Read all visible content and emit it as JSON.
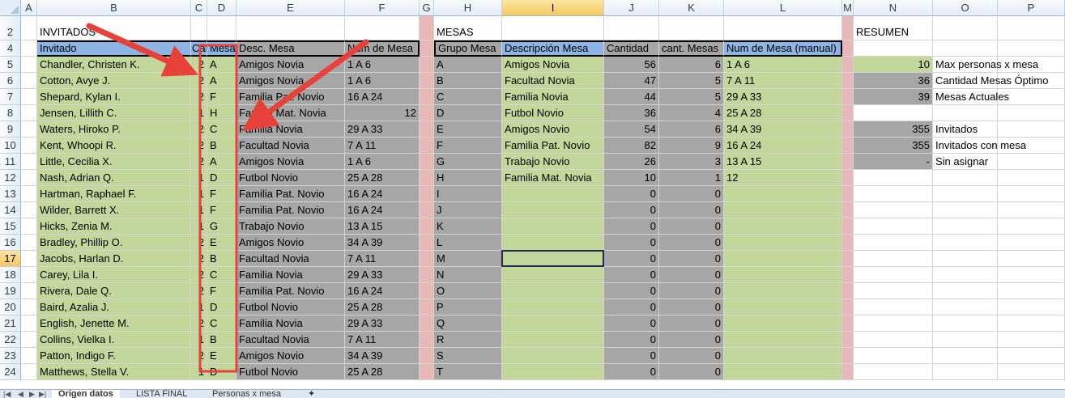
{
  "columns": [
    "A",
    "B",
    "C",
    "D",
    "E",
    "F",
    "G",
    "H",
    "I",
    "J",
    "K",
    "L",
    "M",
    "N",
    "O",
    "P"
  ],
  "selected_column": "I",
  "rows": [
    "2",
    "4",
    "5",
    "6",
    "7",
    "8",
    "9",
    "10",
    "11",
    "12",
    "13",
    "14",
    "15",
    "16",
    "17",
    "18",
    "19",
    "20",
    "21",
    "22",
    "23",
    "24"
  ],
  "selected_row": "17",
  "section_titles": {
    "invitados": "INVITADOS",
    "mesas": "MESAS",
    "resumen": "RESUMEN"
  },
  "headers": {
    "invitado": "Invitado",
    "cant": "Cant",
    "mesa": "Mesa",
    "desc_mesa": "Desc. Mesa",
    "num_mesa": "Num de Mesa",
    "grupo_mesa": "Grupo Mesa",
    "descripcion_mesa": "Descripción Mesa",
    "cantidad": "Cantidad",
    "cant_mesas": "cant. Mesas",
    "num_mesa_manual": "Num de Mesa (manual)"
  },
  "guests": [
    {
      "name": "Chandler, Christen K.",
      "cant": "2",
      "mesa": "A",
      "desc": "Amigos Novia",
      "num": "1 A 6"
    },
    {
      "name": "Cotton, Avye J.",
      "cant": "2",
      "mesa": "A",
      "desc": "Amigos Novia",
      "num": "1 A 6"
    },
    {
      "name": "Shepard, Kylan I.",
      "cant": "2",
      "mesa": "F",
      "desc": "Familia Pat. Novio",
      "num": "16 A 24"
    },
    {
      "name": "Jensen, Lillith C.",
      "cant": "1",
      "mesa": "H",
      "desc": "Familia Mat. Novia",
      "num": "12"
    },
    {
      "name": "Waters, Hiroko P.",
      "cant": "2",
      "mesa": "C",
      "desc": "Familia Novia",
      "num": "29 A 33"
    },
    {
      "name": "Kent, Whoopi R.",
      "cant": "2",
      "mesa": "B",
      "desc": "Facultad  Novia",
      "num": "7 A 11"
    },
    {
      "name": "Little, Cecilia X.",
      "cant": "2",
      "mesa": "A",
      "desc": "Amigos Novia",
      "num": "1 A 6"
    },
    {
      "name": "Nash, Adrian Q.",
      "cant": "1",
      "mesa": "D",
      "desc": "Futbol Novio",
      "num": "25 A 28"
    },
    {
      "name": "Hartman, Raphael F.",
      "cant": "1",
      "mesa": "F",
      "desc": "Familia Pat. Novio",
      "num": "16 A 24"
    },
    {
      "name": "Wilder, Barrett X.",
      "cant": "1",
      "mesa": "F",
      "desc": "Familia Pat. Novio",
      "num": "16 A 24"
    },
    {
      "name": "Hicks, Zenia M.",
      "cant": "1",
      "mesa": "G",
      "desc": "Trabajo Novio",
      "num": "13 A 15"
    },
    {
      "name": "Bradley, Phillip O.",
      "cant": "2",
      "mesa": "E",
      "desc": "Amigos Novio",
      "num": "34 A 39"
    },
    {
      "name": "Jacobs, Harlan D.",
      "cant": "2",
      "mesa": "B",
      "desc": "Facultad  Novia",
      "num": "7 A 11"
    },
    {
      "name": "Carey, Lila I.",
      "cant": "2",
      "mesa": "C",
      "desc": "Familia Novia",
      "num": "29 A 33"
    },
    {
      "name": "Rivera, Dale Q.",
      "cant": "2",
      "mesa": "F",
      "desc": "Familia Pat. Novio",
      "num": "16 A 24"
    },
    {
      "name": "Baird, Azalia J.",
      "cant": "1",
      "mesa": "D",
      "desc": "Futbol Novio",
      "num": "25 A 28"
    },
    {
      "name": "English, Jenette M.",
      "cant": "2",
      "mesa": "C",
      "desc": "Familia Novia",
      "num": "29 A 33"
    },
    {
      "name": "Collins, Vielka I.",
      "cant": "1",
      "mesa": "B",
      "desc": "Facultad  Novia",
      "num": "7 A 11"
    },
    {
      "name": "Patton, Indigo F.",
      "cant": "2",
      "mesa": "E",
      "desc": "Amigos Novio",
      "num": "34 A 39"
    },
    {
      "name": "Matthews, Stella V.",
      "cant": "1",
      "mesa": "D",
      "desc": "Futbol Novio",
      "num": "25 A 28"
    }
  ],
  "mesas": [
    {
      "grupo": "A",
      "desc": "Amigos Novia",
      "cantidad": "56",
      "cant_mesas": "6",
      "num": "1 A 6"
    },
    {
      "grupo": "B",
      "desc": "Facultad  Novia",
      "cantidad": "47",
      "cant_mesas": "5",
      "num": "7 A 11"
    },
    {
      "grupo": "C",
      "desc": "Familia Novia",
      "cantidad": "44",
      "cant_mesas": "5",
      "num": "29 A 33"
    },
    {
      "grupo": "D",
      "desc": "Futbol Novio",
      "cantidad": "36",
      "cant_mesas": "4",
      "num": "25 A 28"
    },
    {
      "grupo": "E",
      "desc": "Amigos Novio",
      "cantidad": "54",
      "cant_mesas": "6",
      "num": "34 A 39"
    },
    {
      "grupo": "F",
      "desc": "Familia Pat. Novio",
      "cantidad": "82",
      "cant_mesas": "9",
      "num": "16 A 24"
    },
    {
      "grupo": "G",
      "desc": "Trabajo Novio",
      "cantidad": "26",
      "cant_mesas": "3",
      "num": "13 A 15"
    },
    {
      "grupo": "H",
      "desc": "Familia Mat. Novia",
      "cantidad": "10",
      "cant_mesas": "1",
      "num": "12"
    },
    {
      "grupo": "I",
      "desc": "",
      "cantidad": "0",
      "cant_mesas": "0",
      "num": ""
    },
    {
      "grupo": "J",
      "desc": "",
      "cantidad": "0",
      "cant_mesas": "0",
      "num": ""
    },
    {
      "grupo": "K",
      "desc": "",
      "cantidad": "0",
      "cant_mesas": "0",
      "num": ""
    },
    {
      "grupo": "L",
      "desc": "",
      "cantidad": "0",
      "cant_mesas": "0",
      "num": ""
    },
    {
      "grupo": "M",
      "desc": "",
      "cantidad": "0",
      "cant_mesas": "0",
      "num": ""
    },
    {
      "grupo": "N",
      "desc": "",
      "cantidad": "0",
      "cant_mesas": "0",
      "num": ""
    },
    {
      "grupo": "O",
      "desc": "",
      "cantidad": "0",
      "cant_mesas": "0",
      "num": ""
    },
    {
      "grupo": "P",
      "desc": "",
      "cantidad": "0",
      "cant_mesas": "0",
      "num": ""
    },
    {
      "grupo": "Q",
      "desc": "",
      "cantidad": "0",
      "cant_mesas": "0",
      "num": ""
    },
    {
      "grupo": "R",
      "desc": "",
      "cantidad": "0",
      "cant_mesas": "0",
      "num": ""
    },
    {
      "grupo": "S",
      "desc": "",
      "cantidad": "0",
      "cant_mesas": "0",
      "num": ""
    },
    {
      "grupo": "T",
      "desc": "",
      "cantidad": "0",
      "cant_mesas": "0",
      "num": ""
    }
  ],
  "resumen": [
    {
      "value": "10",
      "label": "Max personas x mesa",
      "style": "green"
    },
    {
      "value": "36",
      "label": "Cantidad Mesas Óptimo",
      "style": "gray"
    },
    {
      "value": "39",
      "label": "Mesas Actuales",
      "style": "gray"
    },
    {
      "value": "",
      "label": "",
      "style": "none"
    },
    {
      "value": "355",
      "label": "Invitados",
      "style": "gray"
    },
    {
      "value": "355",
      "label": "Invitados con mesa",
      "style": "gray"
    },
    {
      "value": "-",
      "label": "Sin asignar",
      "style": "gray"
    }
  ],
  "sheet_tabs": [
    "Origen datos",
    "LISTA FINAL",
    "Personas x mesa"
  ],
  "active_tab": "Origen datos",
  "colors": {
    "green": "#c4d79b",
    "gray": "#a6a6a6",
    "pink": "#e6b8b7",
    "blue": "#8db4e2",
    "annotation": "#e8413a"
  }
}
